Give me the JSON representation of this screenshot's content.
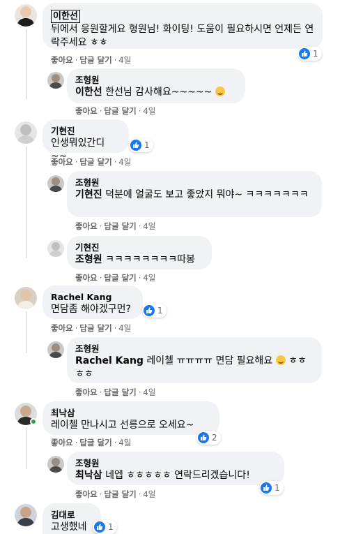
{
  "comments": [
    {
      "author": "이한선",
      "text": "뒤에서 응원할게요 형원님! 화이팅! 도움이 필요하시면 언제든 연락주세요 ㅎㅎ",
      "actions": {
        "like": "좋아요",
        "reply": "답글 달기",
        "time": "4일"
      },
      "likes": "1",
      "replies": [
        {
          "author": "조형원",
          "mention": "이한선",
          "text": " 한선님 감사해요~~~~~ ",
          "actions": {
            "like": "좋아요",
            "reply": "답글 달기",
            "time": "4일"
          }
        }
      ]
    },
    {
      "author": "기현진",
      "text": "인생뭐있간디~~",
      "actions": {
        "like": "좋아요",
        "reply": "답글 달기",
        "time": "4일"
      },
      "likes": "1",
      "replies": [
        {
          "author": "조형원",
          "mention": "기현진",
          "text": " 덕분에 얼굴도 보고 좋았지 뭐야~ ㅋㅋㅋㅋㅋㅋㅋ",
          "actions": {
            "like": "좋아요",
            "reply": "답글 달기",
            "time": "4일"
          }
        },
        {
          "author": "기현진",
          "mention": "조형원",
          "text": " ㅋㅋㅋㅋㅋㅋㅋㅋ따봉",
          "actions": {
            "like": "좋아요",
            "reply": "답글 달기",
            "time": "4일"
          }
        }
      ]
    },
    {
      "author": "Rachel Kang",
      "text": "면담좀 해야겠구먼?",
      "actions": {
        "like": "좋아요",
        "reply": "답글 달기",
        "time": "4일"
      },
      "likes": "1",
      "replies": [
        {
          "author": "조형원",
          "mention": "Rachel Kang",
          "text": " 레이첼 ㅠㅠㅠㅠ 면담 필요해요 ",
          "text2": " ㅎㅎㅎㅎ",
          "actions": {
            "like": "좋아요",
            "reply": "답글 달기",
            "time": "4일"
          }
        }
      ]
    },
    {
      "author": "최낙삼",
      "text": "레이첼 만나시고 선릉으로 오세요~",
      "actions": {
        "like": "좋아요",
        "reply": "답글 달기",
        "time": "4일"
      },
      "likes": "2",
      "replies": [
        {
          "author": "조형원",
          "mention": "최낙삼",
          "text": " 네엡 ㅎㅎㅎㅎㅎ 연락드리겠습니다!",
          "actions": {
            "like": "좋아요",
            "reply": "답글 달기",
            "time": "4일"
          },
          "likes": "1"
        }
      ]
    },
    {
      "author": "김대로",
      "text": "고생했네",
      "likes": "1"
    }
  ],
  "colors": {
    "bubble": "#f0f2f5",
    "like_blue": "#1877f2",
    "meta_gray": "#65676b",
    "online_green": "#31a24c"
  }
}
